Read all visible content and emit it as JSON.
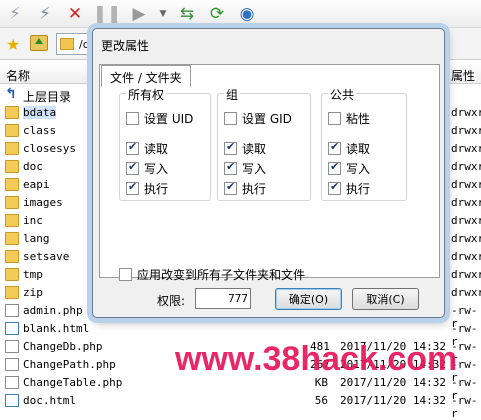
{
  "toolbar": {
    "icons": [
      "connect-icon",
      "disconnect-icon",
      "stop-icon",
      "pause-icon",
      "transfer-icon",
      "sync-icon",
      "refresh-icon",
      "globe-icon"
    ]
  },
  "address": {
    "path": "/d"
  },
  "list": {
    "header_name": "名称",
    "header_attr": "属性",
    "rows": [
      {
        "name": "上层目录",
        "type": "parent",
        "size": "",
        "date": "",
        "attr": ""
      },
      {
        "name": "bdata",
        "type": "folder",
        "size": "",
        "date": "",
        "attr": "drwxr"
      },
      {
        "name": "class",
        "type": "folder",
        "size": "",
        "date": "",
        "attr": "drwxr"
      },
      {
        "name": "closesys",
        "type": "folder",
        "size": "",
        "date": "",
        "attr": "drwxr"
      },
      {
        "name": "doc",
        "type": "folder",
        "size": "",
        "date": "",
        "attr": "drwxr"
      },
      {
        "name": "eapi",
        "type": "folder",
        "size": "",
        "date": "",
        "attr": "drwxr"
      },
      {
        "name": "images",
        "type": "folder",
        "size": "",
        "date": "",
        "attr": "drwxr"
      },
      {
        "name": "inc",
        "type": "folder",
        "size": "",
        "date": "",
        "attr": "drwxr"
      },
      {
        "name": "lang",
        "type": "folder",
        "size": "",
        "date": "",
        "attr": "drwxr"
      },
      {
        "name": "setsave",
        "type": "folder",
        "size": "",
        "date": "",
        "attr": "drwxr"
      },
      {
        "name": "tmp",
        "type": "folder",
        "size": "",
        "date": "",
        "attr": "drwxr"
      },
      {
        "name": "zip",
        "type": "folder",
        "size": "",
        "date": "",
        "attr": "drwxr"
      },
      {
        "name": "admin.php",
        "type": "file",
        "size": "",
        "date": "",
        "attr": "-rw-r"
      },
      {
        "name": "blank.html",
        "type": "html",
        "size": "",
        "date": "",
        "attr": "-rw-r"
      },
      {
        "name": "ChangeDb.php",
        "type": "file",
        "size": "481",
        "date": "2017/11/20 14:32",
        "attr": "-rw-r"
      },
      {
        "name": "ChangePath.php",
        "type": "file",
        "size": "267",
        "date": "2017/11/20 14:32",
        "attr": "-rw-r"
      },
      {
        "name": "ChangeTable.php",
        "type": "file",
        "size": "KB",
        "date": "2017/11/20 14:32",
        "attr": "-rw-r"
      },
      {
        "name": "doc.html",
        "type": "html",
        "size": "56",
        "date": "2017/11/20 14:32",
        "attr": "-rw-r"
      }
    ]
  },
  "dialog": {
    "title": "更改属性",
    "tab": "文件 / 文件夹",
    "owner": {
      "label": "所有权",
      "special": "设置 UID",
      "read": "读取",
      "write": "写入",
      "exec": "执行"
    },
    "group": {
      "label": "组",
      "special": "设置 GID",
      "read": "读取",
      "write": "写入",
      "exec": "执行"
    },
    "public": {
      "label": "公共",
      "special": "粘性",
      "read": "读取",
      "write": "写入",
      "exec": "执行"
    },
    "apply_recursive": "应用改变到所有子文件夹和文件",
    "perm_label": "权限:",
    "perm_value": "777",
    "ok_label": "确定(O)",
    "cancel_label": "取消(C)"
  },
  "watermark": "www.38hack.com"
}
